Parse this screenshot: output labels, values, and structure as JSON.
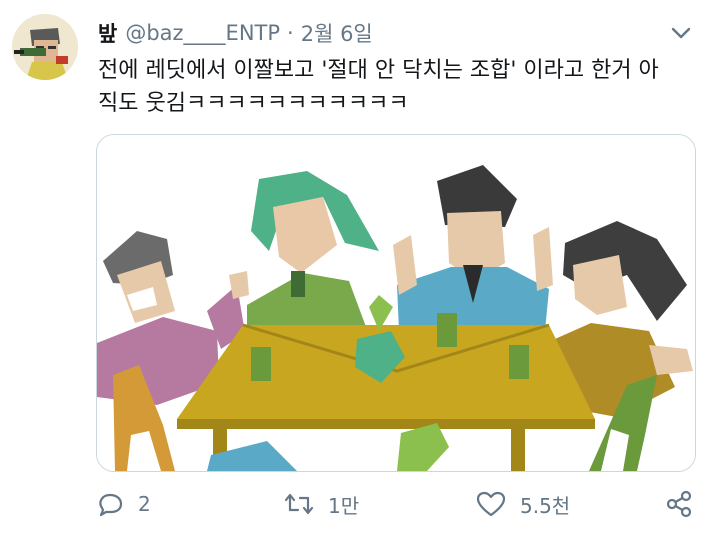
{
  "tweet": {
    "display_name": "밮",
    "handle": "@baz____ENTP",
    "separator": "·",
    "date": "2월 6일",
    "text_line1": "전에 레딧에서 이짤보고 '절대 안 닥치는 조합' 이라고 한거 아",
    "text_line2": "직도 웃김ㅋㅋㅋㅋㅋㅋㅋㅋㅋㅋㅋ"
  },
  "actions": {
    "reply_count": "2",
    "retweet_count": "1만",
    "like_count": "5.5천"
  },
  "icons": {
    "more": "chevron-down-icon",
    "reply": "comment-icon",
    "retweet": "retweet-icon",
    "like": "heart-icon",
    "share": "share-icon"
  },
  "colors": {
    "secondary_text": "#657786",
    "table": "#c9a620",
    "border": "#ccd6dd"
  }
}
